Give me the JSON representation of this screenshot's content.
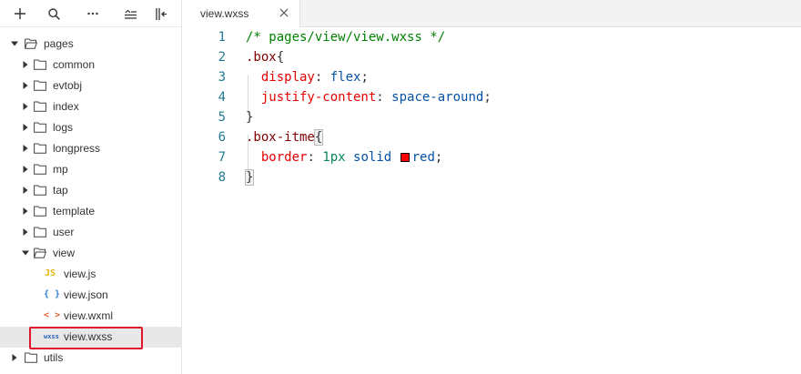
{
  "toolbar": {
    "buttons": [
      "add-icon",
      "search-icon",
      "more-icon",
      "collapse-list-icon",
      "collapse-sidebar-icon"
    ]
  },
  "tree": [
    {
      "label": "pages",
      "depth": 0,
      "kind": "folder",
      "open": true
    },
    {
      "label": "common",
      "depth": 1,
      "kind": "folder",
      "open": false
    },
    {
      "label": "evtobj",
      "depth": 1,
      "kind": "folder",
      "open": false
    },
    {
      "label": "index",
      "depth": 1,
      "kind": "folder",
      "open": false
    },
    {
      "label": "logs",
      "depth": 1,
      "kind": "folder",
      "open": false
    },
    {
      "label": "longpress",
      "depth": 1,
      "kind": "folder",
      "open": false
    },
    {
      "label": "mp",
      "depth": 1,
      "kind": "folder",
      "open": false
    },
    {
      "label": "tap",
      "depth": 1,
      "kind": "folder",
      "open": false
    },
    {
      "label": "template",
      "depth": 1,
      "kind": "folder",
      "open": false
    },
    {
      "label": "user",
      "depth": 1,
      "kind": "folder",
      "open": false
    },
    {
      "label": "view",
      "depth": 1,
      "kind": "folder",
      "open": true
    },
    {
      "label": "view.js",
      "depth": 2,
      "kind": "file",
      "icon": "JS",
      "icon_color": "#e8b512"
    },
    {
      "label": "view.json",
      "depth": 2,
      "kind": "file",
      "icon": "{ }",
      "icon_color": "#2b7fd1"
    },
    {
      "label": "view.wxml",
      "depth": 2,
      "kind": "file",
      "icon": "< >",
      "icon_color": "#e5642b"
    },
    {
      "label": "view.wxss",
      "depth": 2,
      "kind": "file",
      "icon": "wxss",
      "icon_color": "#2b62b5",
      "selected": true
    },
    {
      "label": "utils",
      "depth": 0,
      "kind": "folder",
      "open": false
    }
  ],
  "tab": {
    "label": "view.wxss",
    "close": "close-icon"
  },
  "editor": {
    "swatch_color": "#ff0000",
    "lines": [
      {
        "num": "1",
        "text": "/* pages/view/view.wxss */"
      },
      {
        "num": "2",
        "text": ".box{"
      },
      {
        "num": "3",
        "text": "  display: flex;"
      },
      {
        "num": "4",
        "text": "  justify-content: space-around;"
      },
      {
        "num": "5",
        "text": "}"
      },
      {
        "num": "6",
        "text": ".box-itme{"
      },
      {
        "num": "7",
        "text": "  border: 1px solid red;"
      },
      {
        "num": "8",
        "text": "}"
      }
    ]
  }
}
